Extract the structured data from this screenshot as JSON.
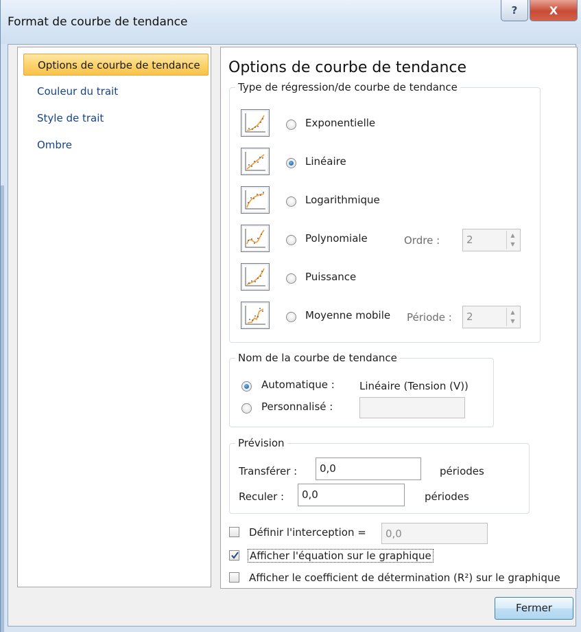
{
  "window": {
    "title": "Format de courbe de tendance",
    "help_glyph": "?",
    "close_glyph": "X"
  },
  "sidebar": {
    "items": [
      {
        "label": "Options de courbe de tendance",
        "selected": true
      },
      {
        "label": "Couleur du trait",
        "selected": false
      },
      {
        "label": "Style de trait",
        "selected": false
      },
      {
        "label": "Ombre",
        "selected": false
      }
    ]
  },
  "main": {
    "heading": "Options de courbe de tendance",
    "regression": {
      "legend": "Type de régression/de courbe de tendance",
      "options": [
        {
          "label": "Exponentielle",
          "checked": false,
          "icon": "exponential-trend-icon"
        },
        {
          "label": "Linéaire",
          "checked": true,
          "icon": "linear-trend-icon"
        },
        {
          "label": "Logarithmique",
          "checked": false,
          "icon": "logarithmic-trend-icon"
        },
        {
          "label": "Polynomiale",
          "checked": false,
          "icon": "polynomial-trend-icon"
        },
        {
          "label": "Puissance",
          "checked": false,
          "icon": "power-trend-icon"
        },
        {
          "label": "Moyenne mobile",
          "checked": false,
          "icon": "moving-average-trend-icon"
        }
      ],
      "order_label": "Ordre :",
      "order_value": "2",
      "period_label": "Période :",
      "period_value": "2"
    },
    "name": {
      "legend": "Nom de la courbe de tendance",
      "automatic_label": "Automatique :",
      "automatic_value": "Linéaire (Tension (V))",
      "custom_label": "Personnalisé :",
      "custom_value": ""
    },
    "forecast": {
      "legend": "Prévision",
      "forward_label": "Transférer :",
      "forward_value": "0,0",
      "backward_label": "Reculer :",
      "backward_value": "0,0",
      "unit": "périodes"
    },
    "intercept": {
      "label": "Définir l'interception =",
      "value": "0,0",
      "checked": false
    },
    "show_equation": {
      "label": "Afficher l'équation sur le graphique",
      "checked": true
    },
    "show_r2": {
      "label": "Afficher le coefficient de détermination (R²) sur le graphique",
      "checked": false
    }
  },
  "footer": {
    "close_label": "Fermer"
  },
  "colors": {
    "accent_selected": "#fbd46d",
    "nav_text": "#15428b",
    "trend_line": "#f39a2a"
  }
}
